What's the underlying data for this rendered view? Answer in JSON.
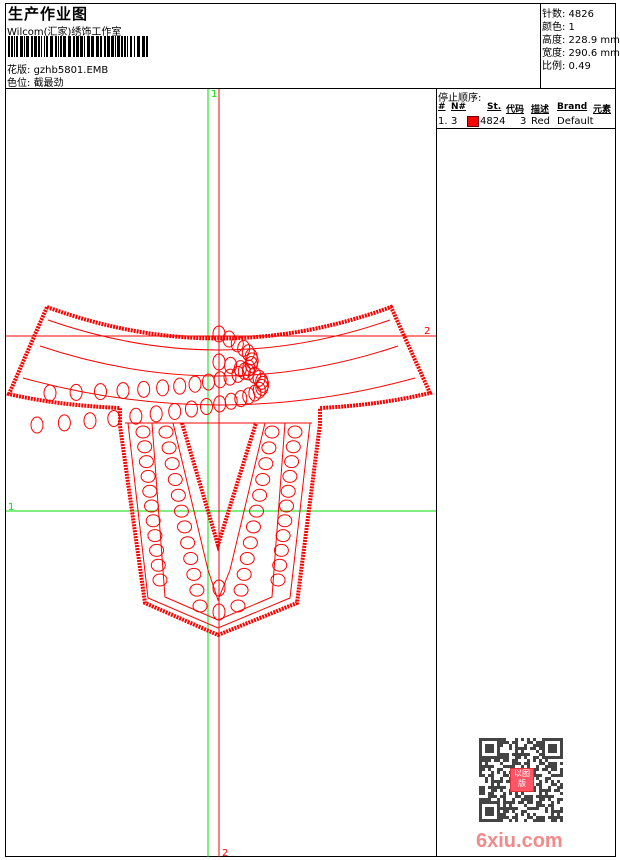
{
  "header": {
    "title": "生产作业图",
    "company": "Wilcom(汇家)绣饰工作室",
    "design_label": "花版:",
    "design_file": "gzhb5801.EMB",
    "color_label": "色位:",
    "color_value": "截最劲"
  },
  "info": {
    "stitches": "针数: 4826",
    "colors": "颜色: 1",
    "height": "高度: 228.9 mm",
    "width": "宽度: 290.6 mm",
    "scale": "比例: 0.49"
  },
  "stop_sequence": {
    "title": "停止顺序:",
    "columns": [
      "#",
      "N#",
      "St.",
      "代码",
      "描述",
      "Brand",
      "元素"
    ],
    "rows": [
      {
        "index": "1.",
        "needle": "3",
        "color": "#ff0000",
        "stitches": "4824",
        "code": "3",
        "desc": "Red",
        "brand": "Default",
        "element": ""
      }
    ]
  },
  "guides": {
    "red_h": "2",
    "red_v": "2",
    "green_h": "1",
    "green_v": "1"
  },
  "colors": {
    "thread": "#ff0000",
    "guide_red": "#ff0000",
    "guide_green": "#00dd00"
  },
  "watermark": {
    "site": "6xiu.com",
    "stamp": "以图版"
  }
}
